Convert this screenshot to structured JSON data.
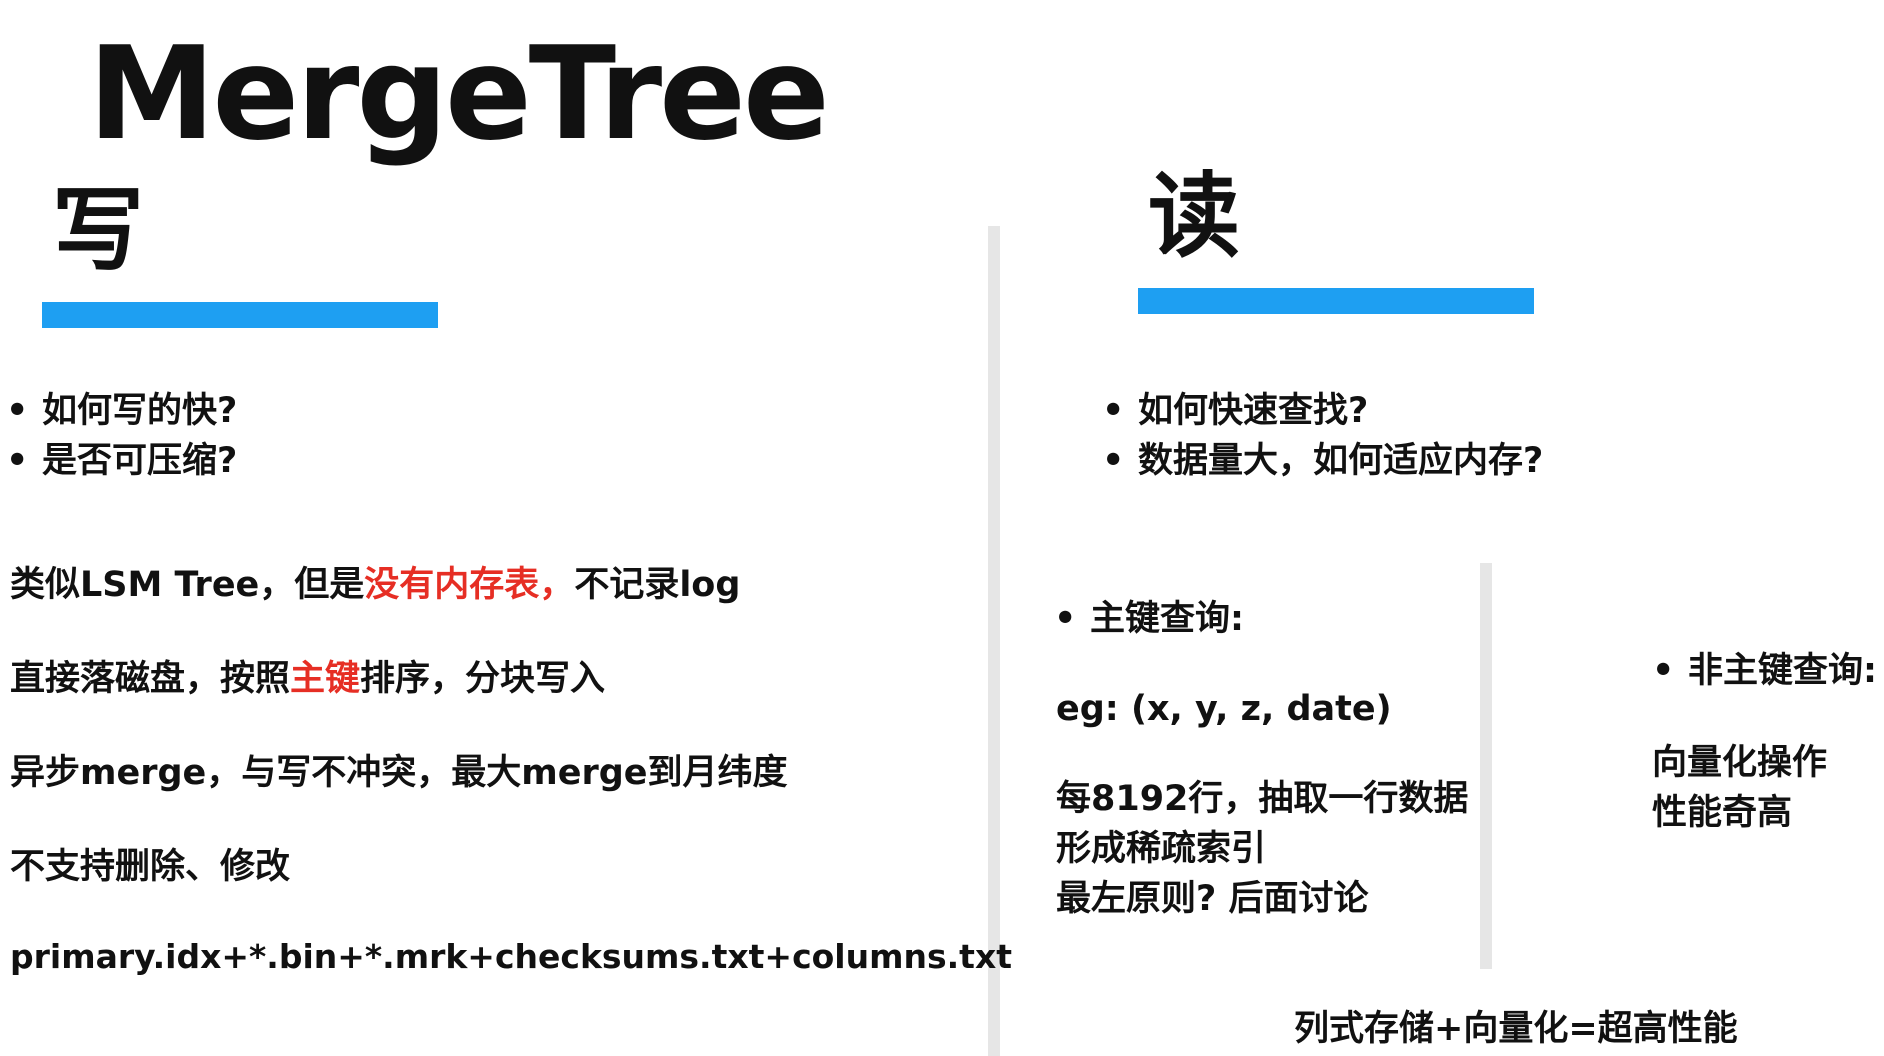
{
  "title": "MergeTree",
  "write": {
    "heading": "写",
    "bullets": [
      "如何写的快?",
      "是否可压缩?"
    ],
    "line1": {
      "a": "类似LSM Tree，但是",
      "b": "没有内存表，",
      "c": "不记录log"
    },
    "line2": {
      "a": "直接落磁盘，按照",
      "b": "主键",
      "c": "排序，分块写入"
    },
    "line3": "异步merge，与写不冲突，最大merge到月纬度",
    "line4": "不支持删除、修改",
    "line5": "primary.idx+*.bin+*.mrk+checksums.txt+columns.txt"
  },
  "read": {
    "heading": "读",
    "bullets": [
      "如何快速查找?",
      "数据量大，如何适应内存?"
    ],
    "primary": {
      "title": "主键查询:",
      "example": "eg: (x, y, z, date)",
      "lines": [
        "每8192行，抽取一行数据",
        "形成稀疏索引",
        "最左原则? 后面讨论"
      ]
    },
    "nonprimary": {
      "title": "非主键查询:",
      "lines": [
        "向量化操作",
        "性能奇高"
      ]
    },
    "footer": "列式存储+向量化=超高性能"
  },
  "colors": {
    "accent": "#1e9ff2",
    "highlight": "#e62e24",
    "divider": "#e6e6e6"
  }
}
